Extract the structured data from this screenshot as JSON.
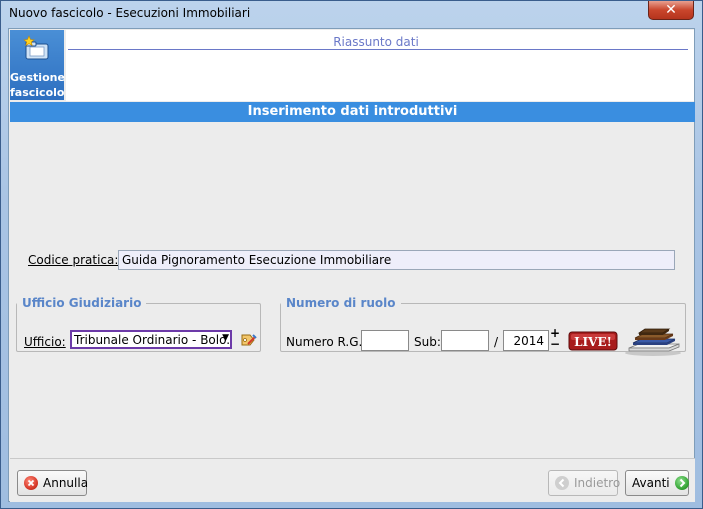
{
  "window": {
    "title": "Nuovo fascicolo - Esecuzioni Immobiliari",
    "close_glyph": "✕"
  },
  "sidebar": {
    "tile_label_line1": "Gestione",
    "tile_label_line2": "fascicolo",
    "tile_icon": "folder-star-icon"
  },
  "summary": {
    "title": "Riassunto dati"
  },
  "section": {
    "title": "Inserimento dati introduttivi"
  },
  "codice": {
    "label": "Codice pratica:",
    "value": "Guida Pignoramento Esecuzione Immobiliare"
  },
  "ufficio_group": {
    "legend": "Ufficio Giudiziario",
    "label": "Ufficio:",
    "selected": "Tribunale Ordinario - Bolo..."
  },
  "ruolo_group": {
    "legend": "Numero di ruolo",
    "rg_label": "Numero R.G.:",
    "rg_value": "",
    "sub_label": "Sub:",
    "sub_value": "",
    "slash": "/",
    "year": "2014",
    "stepper_plus": "+",
    "stepper_minus": "−",
    "live_label": "LIVE!"
  },
  "buttons": {
    "cancel": "Annulla",
    "back": "Indietro",
    "next": "Avanti"
  },
  "colors": {
    "accent_blue": "#3a8ee0",
    "legend_blue": "#5a86c9",
    "cancel_red": "#d83a2a",
    "next_green": "#3aa83a"
  }
}
